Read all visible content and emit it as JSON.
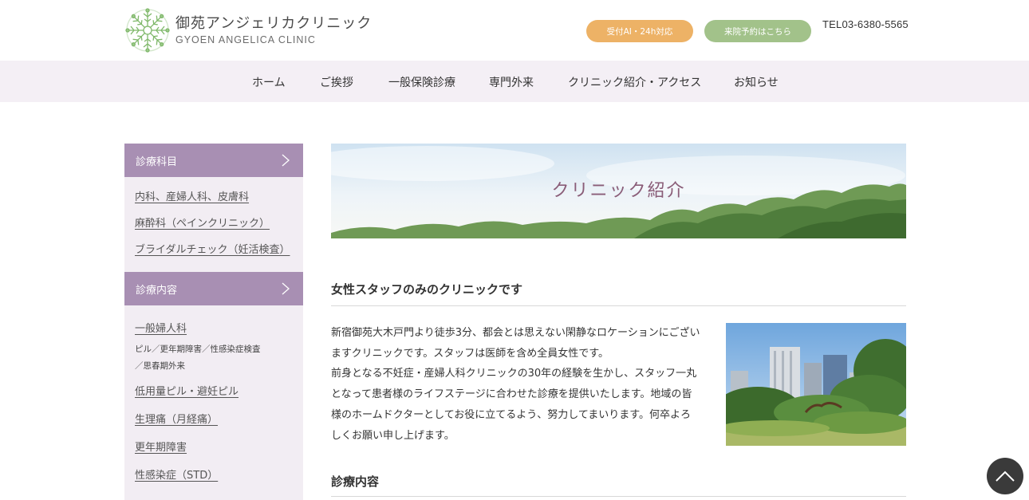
{
  "header": {
    "logo_jp": "御苑アンジェリカクリニック",
    "logo_en": "GYOEN ANGELICA CLINIC",
    "btn_ai": "受付AI・24h対応",
    "btn_visit": "来院予約はこちら",
    "tel": "TEL03-6380-5565"
  },
  "nav": [
    "ホーム",
    "ご挨拶",
    "一般保険診療",
    "専門外来",
    "クリニック紹介・アクセス",
    "お知らせ"
  ],
  "sidebar": {
    "section1_title": "診療科目",
    "section1_links": [
      "内科、産婦人科、皮膚科",
      "麻酔科（ペインクリニック）",
      "ブライダルチェック（妊活検査）"
    ],
    "section2_title": "診療内容",
    "section2_link1": "一般婦人科",
    "section2_sub1": "ピル／更年期障害／性感染症検査",
    "section2_sub2": "／思春期外来",
    "section2_links": [
      "低用量ピル・避妊ピル",
      "生理痛（月経痛）",
      "更年期障害",
      "性感染症（STD）"
    ]
  },
  "main": {
    "banner_title": "クリニック紹介",
    "heading1": "女性スタッフのみのクリニックです",
    "paragraph_lines": [
      "新宿御苑大木戸門より徒歩3分、都会とは思えない閑静なロケーションにござい",
      "ますクリニックです。スタッフは医師を含め全員女性です。",
      "前身となる不妊症・産婦人科クリニックの30年の経験を生かし、スタッフ一丸",
      "となって患者様のライフステージに合わせた診療を提供いたします。地域の皆",
      "様のホームドクターとしてお役に立てるよう、努力してまいります。何卒よろ",
      "しくお願い申し上げます。"
    ],
    "heading2": "診療内容"
  },
  "colors": {
    "nav_bg": "#f4eff5",
    "sidebar_head": "#a88fb3",
    "sidebar_bg": "#f2edf3",
    "btn_ai": "#edb266",
    "btn_visit": "#a2c28a",
    "banner_title": "#8a5d78"
  },
  "icons": {
    "logo": "snowflake-flower-logo-icon",
    "sidebar_chevron": "chevron-right-icon",
    "back_to_top": "chevron-up-icon"
  }
}
